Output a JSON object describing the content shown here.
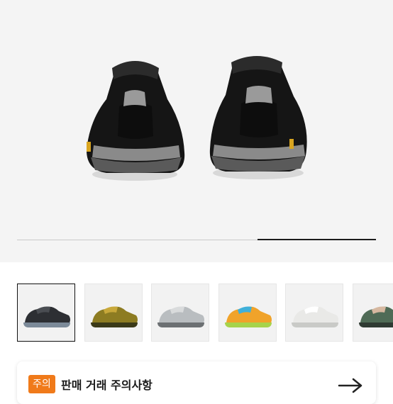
{
  "hero": {
    "image": "black-trail-running-shoes-rear-view",
    "gallery_progress": 0.33
  },
  "thumbnails": [
    {
      "name": "black-shoe-thumbnail",
      "colors": [
        "#2d2f33",
        "#4a4d52",
        "#7c8a99"
      ],
      "selected": true
    },
    {
      "name": "olive-shoe-thumbnail",
      "colors": [
        "#8d7c22",
        "#c8a83a",
        "#3b3a18"
      ],
      "selected": false
    },
    {
      "name": "grey-shoe-thumbnail",
      "colors": [
        "#b9bdc0",
        "#d9dbdc",
        "#6c7073"
      ],
      "selected": false
    },
    {
      "name": "multicolor-shoe-thumbnail",
      "colors": [
        "#f0a32a",
        "#3fb0d9",
        "#a7d34b"
      ],
      "selected": false
    },
    {
      "name": "white-shoe-thumbnail",
      "colors": [
        "#e9e9e7",
        "#ffffff",
        "#c9cac7"
      ],
      "selected": false
    },
    {
      "name": "green-shoe-thumbnail",
      "colors": [
        "#4f6b56",
        "#d6b8a0",
        "#2f3b33"
      ],
      "selected": false
    }
  ],
  "notice": {
    "badge": "주의",
    "title": "판매 거래 주의사항",
    "arrow_icon": "arrow-right-icon",
    "accent": "#f07a1a"
  }
}
